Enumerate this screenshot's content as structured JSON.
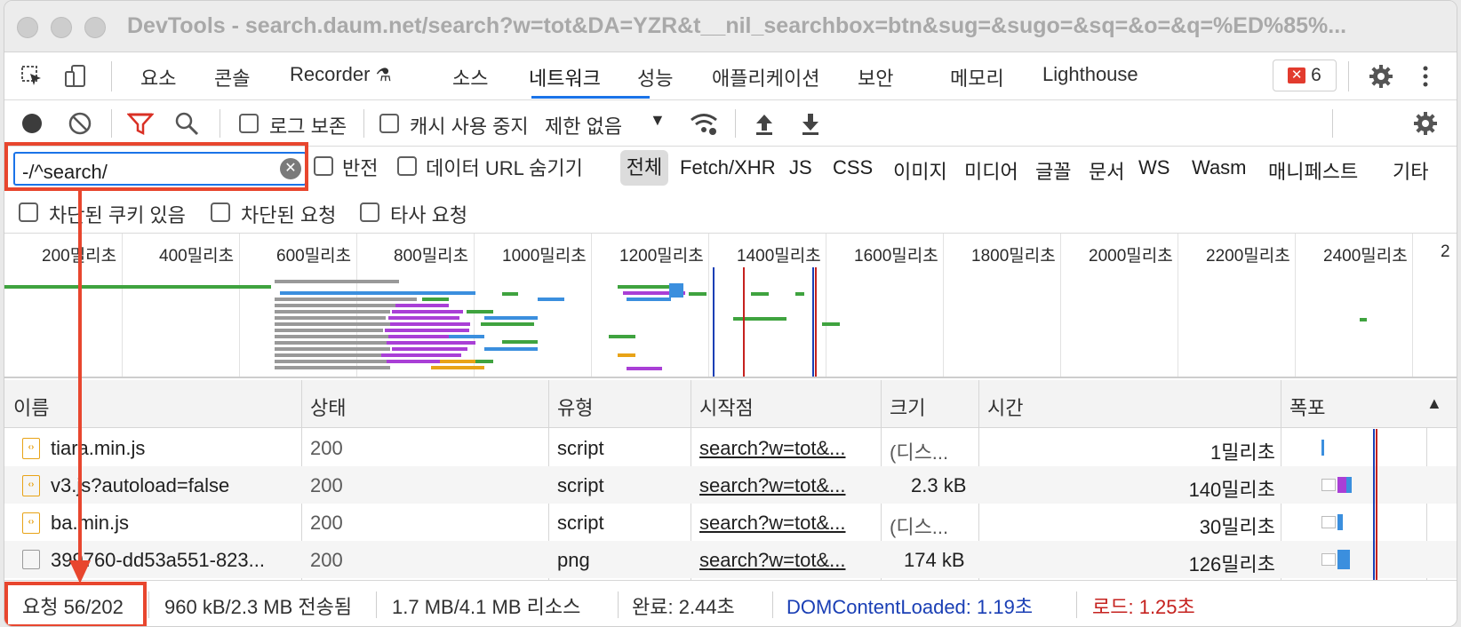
{
  "window": {
    "title": "DevTools - search.daum.net/search?w=tot&DA=YZR&t__nil_searchbox=btn&sug=&sugo=&sq=&o=&q=%ED%85%..."
  },
  "tabs": [
    {
      "label": "요소"
    },
    {
      "label": "콘솔"
    },
    {
      "label": "Recorder"
    },
    {
      "label": "소스"
    },
    {
      "label": "네트워크",
      "active": true
    },
    {
      "label": "성능"
    },
    {
      "label": "애플리케이션"
    },
    {
      "label": "보안"
    },
    {
      "label": "메모리"
    },
    {
      "label": "Lighthouse"
    }
  ],
  "error_count": "6",
  "toolbar": {
    "preserve_log": "로그 보존",
    "disable_cache": "캐시 사용 중지",
    "throttle": "제한 없음"
  },
  "filter": {
    "value": "-/^search/",
    "invert": "반전",
    "hide_data_urls": "데이터 URL 숨기기",
    "types": [
      "전체",
      "Fetch/XHR",
      "JS",
      "CSS",
      "이미지",
      "미디어",
      "글꼴",
      "문서",
      "WS",
      "Wasm",
      "매니페스트",
      "기타"
    ],
    "blocked_cookies": "차단된 쿠키 있음",
    "blocked_requests": "차단된 요청",
    "third_party": "타사 요청"
  },
  "timeline": {
    "ticks": [
      "200밀리초",
      "400밀리초",
      "600밀리초",
      "800밀리초",
      "1000밀리초",
      "1200밀리초",
      "1400밀리초",
      "1600밀리초",
      "1800밀리초",
      "2000밀리초",
      "2200밀리초",
      "2400밀리초",
      "2"
    ]
  },
  "table": {
    "columns": [
      "이름",
      "상태",
      "유형",
      "시작점",
      "크기",
      "시간",
      "폭포"
    ],
    "rows": [
      {
        "name": "tiara.min.js",
        "status": "200",
        "type": "script",
        "initiator": "search?w=tot&...",
        "size": "(디스...",
        "time": "1밀리초",
        "icon": "script-file-icon"
      },
      {
        "name": "v3.js?autoload=false",
        "status": "200",
        "type": "script",
        "initiator": "search?w=tot&...",
        "size": "2.3 kB",
        "time": "140밀리초",
        "icon": "script-file-icon"
      },
      {
        "name": "ba.min.js",
        "status": "200",
        "type": "script",
        "initiator": "search?w=tot&...",
        "size": "(디스...",
        "time": "30밀리초",
        "icon": "script-file-icon"
      },
      {
        "name": "399760-dd53a551-823...",
        "status": "200",
        "type": "png",
        "initiator": "search?w=tot&...",
        "size": "174 kB",
        "time": "126밀리초",
        "icon": "image-file-icon"
      }
    ]
  },
  "status": {
    "requests": "요청 56/202",
    "transferred": "960 kB/2.3 MB 전송됨",
    "resources": "1.7 MB/4.1 MB 리소스",
    "finish": "완료: 2.44초",
    "dcl": "DOMContentLoaded: 1.19초",
    "load": "로드: 1.25초"
  },
  "colors": {
    "accent": "#1a73e8",
    "highlight": "#e8462e",
    "dcl": "#1a3fb5",
    "load": "#c5221f"
  }
}
